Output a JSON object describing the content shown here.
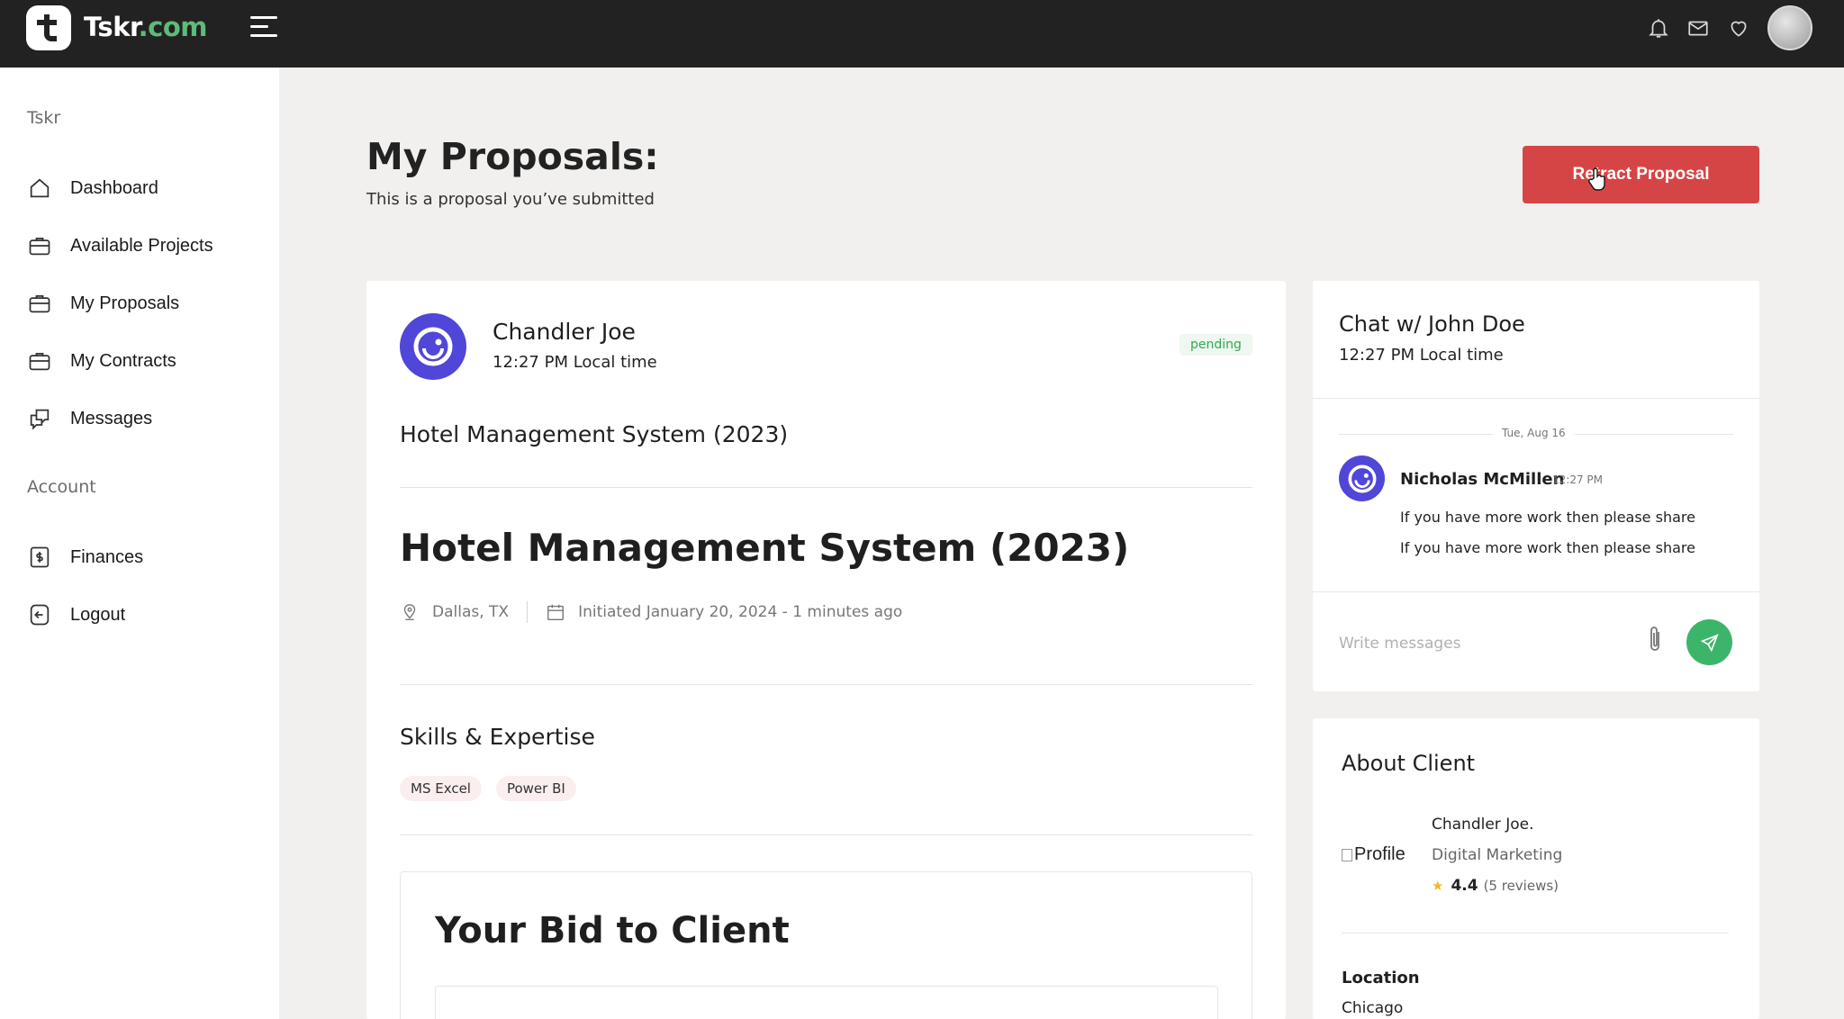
{
  "brand": {
    "name": "Tskr",
    "domain": ".com",
    "accent": "#5dbb7a"
  },
  "topbar": {
    "icons": [
      "bell-icon",
      "mail-icon",
      "heart-icon"
    ]
  },
  "sidebar": {
    "section1": "Tskr",
    "items": [
      {
        "label": "Dashboard",
        "icon": "home-icon"
      },
      {
        "label": "Available Projects",
        "icon": "briefcase-icon"
      },
      {
        "label": "My Proposals",
        "icon": "briefcase-icon"
      },
      {
        "label": "My Contracts",
        "icon": "briefcase-icon"
      },
      {
        "label": "Messages",
        "icon": "chat-icon"
      }
    ],
    "section2": "Account",
    "account_items": [
      {
        "label": "Finances",
        "icon": "dollar-icon"
      },
      {
        "label": "Logout",
        "icon": "logout-icon"
      }
    ]
  },
  "header": {
    "title": "My Proposals:",
    "subtitle": "This is a proposal you’ve submitted",
    "retract_label": "Retract Proposal",
    "retract_color": "#d64545"
  },
  "proposal": {
    "client_name": "Chandler Joe",
    "client_time": "12:27 PM Local time",
    "status": "pending",
    "project_title": "Hotel Management System (2023)",
    "location": "Dallas, TX",
    "initiated": "Initiated January 20, 2024 - 1 minutes ago",
    "skills_title": "Skills & Expertise",
    "skills": [
      "MS Excel",
      "Power BI"
    ],
    "bid_title": "Your Bid to Client"
  },
  "chat": {
    "title": "Chat w/ John Doe",
    "time": "12:27 PM Local time",
    "date_divider": "Tue, Aug 16",
    "sender": "Nicholas McMillen",
    "sent_time": "12:27 PM",
    "messages": [
      "If you have more work then please share",
      "If you have more work then please share"
    ],
    "input_placeholder": "Write messages",
    "send_color": "#3cb56a"
  },
  "about_client": {
    "title": "About Client",
    "image_alt": "Profile",
    "name": "Chandler Joe.",
    "role": "Digital Marketing",
    "rating": "4.4",
    "reviews": "(5 reviews)",
    "location_label": "Location",
    "location": "Chicago"
  }
}
